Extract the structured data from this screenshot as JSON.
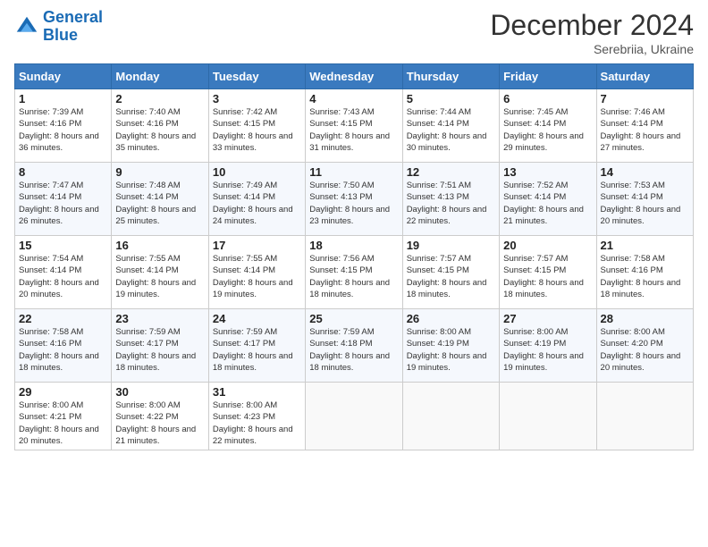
{
  "logo": {
    "line1": "General",
    "line2": "Blue"
  },
  "title": "December 2024",
  "subtitle": "Serebriia, Ukraine",
  "weekdays": [
    "Sunday",
    "Monday",
    "Tuesday",
    "Wednesday",
    "Thursday",
    "Friday",
    "Saturday"
  ],
  "weeks": [
    [
      {
        "day": "1",
        "sunrise": "7:39 AM",
        "sunset": "4:16 PM",
        "daylight": "8 hours and 36 minutes."
      },
      {
        "day": "2",
        "sunrise": "7:40 AM",
        "sunset": "4:16 PM",
        "daylight": "8 hours and 35 minutes."
      },
      {
        "day": "3",
        "sunrise": "7:42 AM",
        "sunset": "4:15 PM",
        "daylight": "8 hours and 33 minutes."
      },
      {
        "day": "4",
        "sunrise": "7:43 AM",
        "sunset": "4:15 PM",
        "daylight": "8 hours and 31 minutes."
      },
      {
        "day": "5",
        "sunrise": "7:44 AM",
        "sunset": "4:14 PM",
        "daylight": "8 hours and 30 minutes."
      },
      {
        "day": "6",
        "sunrise": "7:45 AM",
        "sunset": "4:14 PM",
        "daylight": "8 hours and 29 minutes."
      },
      {
        "day": "7",
        "sunrise": "7:46 AM",
        "sunset": "4:14 PM",
        "daylight": "8 hours and 27 minutes."
      }
    ],
    [
      {
        "day": "8",
        "sunrise": "7:47 AM",
        "sunset": "4:14 PM",
        "daylight": "8 hours and 26 minutes."
      },
      {
        "day": "9",
        "sunrise": "7:48 AM",
        "sunset": "4:14 PM",
        "daylight": "8 hours and 25 minutes."
      },
      {
        "day": "10",
        "sunrise": "7:49 AM",
        "sunset": "4:14 PM",
        "daylight": "8 hours and 24 minutes."
      },
      {
        "day": "11",
        "sunrise": "7:50 AM",
        "sunset": "4:13 PM",
        "daylight": "8 hours and 23 minutes."
      },
      {
        "day": "12",
        "sunrise": "7:51 AM",
        "sunset": "4:13 PM",
        "daylight": "8 hours and 22 minutes."
      },
      {
        "day": "13",
        "sunrise": "7:52 AM",
        "sunset": "4:14 PM",
        "daylight": "8 hours and 21 minutes."
      },
      {
        "day": "14",
        "sunrise": "7:53 AM",
        "sunset": "4:14 PM",
        "daylight": "8 hours and 20 minutes."
      }
    ],
    [
      {
        "day": "15",
        "sunrise": "7:54 AM",
        "sunset": "4:14 PM",
        "daylight": "8 hours and 20 minutes."
      },
      {
        "day": "16",
        "sunrise": "7:55 AM",
        "sunset": "4:14 PM",
        "daylight": "8 hours and 19 minutes."
      },
      {
        "day": "17",
        "sunrise": "7:55 AM",
        "sunset": "4:14 PM",
        "daylight": "8 hours and 19 minutes."
      },
      {
        "day": "18",
        "sunrise": "7:56 AM",
        "sunset": "4:15 PM",
        "daylight": "8 hours and 18 minutes."
      },
      {
        "day": "19",
        "sunrise": "7:57 AM",
        "sunset": "4:15 PM",
        "daylight": "8 hours and 18 minutes."
      },
      {
        "day": "20",
        "sunrise": "7:57 AM",
        "sunset": "4:15 PM",
        "daylight": "8 hours and 18 minutes."
      },
      {
        "day": "21",
        "sunrise": "7:58 AM",
        "sunset": "4:16 PM",
        "daylight": "8 hours and 18 minutes."
      }
    ],
    [
      {
        "day": "22",
        "sunrise": "7:58 AM",
        "sunset": "4:16 PM",
        "daylight": "8 hours and 18 minutes."
      },
      {
        "day": "23",
        "sunrise": "7:59 AM",
        "sunset": "4:17 PM",
        "daylight": "8 hours and 18 minutes."
      },
      {
        "day": "24",
        "sunrise": "7:59 AM",
        "sunset": "4:17 PM",
        "daylight": "8 hours and 18 minutes."
      },
      {
        "day": "25",
        "sunrise": "7:59 AM",
        "sunset": "4:18 PM",
        "daylight": "8 hours and 18 minutes."
      },
      {
        "day": "26",
        "sunrise": "8:00 AM",
        "sunset": "4:19 PM",
        "daylight": "8 hours and 19 minutes."
      },
      {
        "day": "27",
        "sunrise": "8:00 AM",
        "sunset": "4:19 PM",
        "daylight": "8 hours and 19 minutes."
      },
      {
        "day": "28",
        "sunrise": "8:00 AM",
        "sunset": "4:20 PM",
        "daylight": "8 hours and 20 minutes."
      }
    ],
    [
      {
        "day": "29",
        "sunrise": "8:00 AM",
        "sunset": "4:21 PM",
        "daylight": "8 hours and 20 minutes."
      },
      {
        "day": "30",
        "sunrise": "8:00 AM",
        "sunset": "4:22 PM",
        "daylight": "8 hours and 21 minutes."
      },
      {
        "day": "31",
        "sunrise": "8:00 AM",
        "sunset": "4:23 PM",
        "daylight": "8 hours and 22 minutes."
      },
      null,
      null,
      null,
      null
    ]
  ]
}
